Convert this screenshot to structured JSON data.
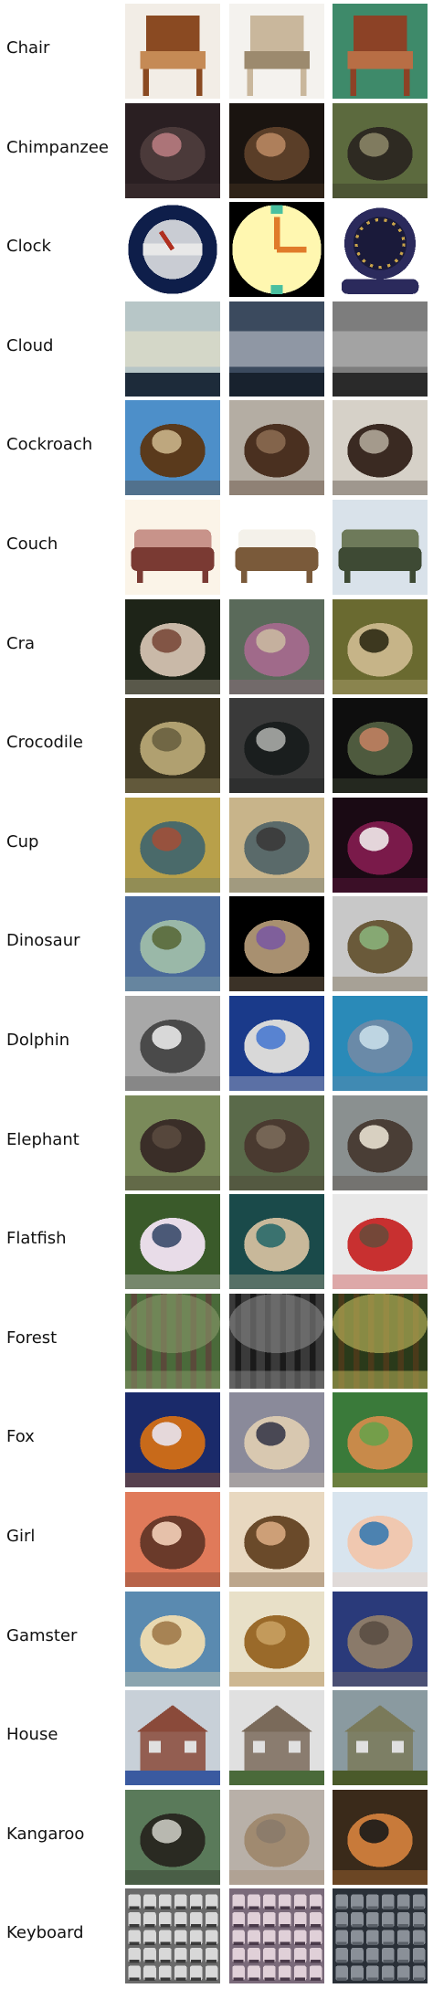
{
  "rows": [
    {
      "label": "Chair",
      "thumbs": [
        {
          "icon": "wooden-chair",
          "bg": "#f2ede6",
          "c1": "#8a4a22",
          "c2": "#c58a55"
        },
        {
          "icon": "padded-armchair",
          "bg": "#f4f2ee",
          "c1": "#c9b79c",
          "c2": "#9c8a6e"
        },
        {
          "icon": "leather-armchair",
          "bg": "#3e8a6a",
          "c1": "#8c4226",
          "c2": "#b86e45"
        }
      ]
    },
    {
      "label": "Chimpanzee",
      "thumbs": [
        {
          "icon": "chimp-face",
          "bg": "#2a1f22",
          "c1": "#4b3a3a",
          "c2": "#b77b7f"
        },
        {
          "icon": "chimp-face-close",
          "bg": "#1a1410",
          "c1": "#5a3e28",
          "c2": "#b78660"
        },
        {
          "icon": "chimp-on-ground",
          "bg": "#5c6a3e",
          "c1": "#2e2a22",
          "c2": "#8a8466"
        }
      ]
    },
    {
      "label": "Clock",
      "thumbs": [
        {
          "icon": "round-clock",
          "bg": "#ffffff",
          "c1": "#0e1e4a",
          "c2": "#c9ccd3"
        },
        {
          "icon": "cartoon-clock",
          "bg": "#000000",
          "c1": "#fff7b0",
          "c2": "#e07b2a"
        },
        {
          "icon": "table-clock",
          "bg": "#ffffff",
          "c1": "#2b2a5c",
          "c2": "#c9a44a"
        }
      ]
    },
    {
      "label": "Cloud",
      "thumbs": [
        {
          "icon": "sky-horizon",
          "bg": "#b7c6c7",
          "c1": "#e8e2c8",
          "c2": "#1d2b3a"
        },
        {
          "icon": "sky-horizon",
          "bg": "#3b4a5e",
          "c1": "#c8ccd4",
          "c2": "#18222e"
        },
        {
          "icon": "sky-horizon",
          "bg": "#7d7d7d",
          "c1": "#bdbdbd",
          "c2": "#2a2a2a"
        }
      ]
    },
    {
      "label": "Cockroach",
      "thumbs": [
        {
          "icon": "cockroach-on-wall",
          "bg": "#4d8fc9",
          "c1": "#5a3a1c",
          "c2": "#c9b48a"
        },
        {
          "icon": "cockroach",
          "bg": "#b4ada3",
          "c1": "#4a3020",
          "c2": "#8a6a50"
        },
        {
          "icon": "cockroach-small",
          "bg": "#d6d1c8",
          "c1": "#3a2a22",
          "c2": "#b0a698"
        }
      ]
    },
    {
      "label": "Couch",
      "thumbs": [
        {
          "icon": "small-sofa",
          "bg": "#fbf4e8",
          "c1": "#7a3a33",
          "c2": "#c8938a"
        },
        {
          "icon": "white-sofa",
          "bg": "#ffffff",
          "c1": "#7a5a3a",
          "c2": "#f4f1ea"
        },
        {
          "icon": "camo-sofa",
          "bg": "#d9e2ea",
          "c1": "#3e4a34",
          "c2": "#6e7a5a"
        }
      ]
    },
    {
      "label": "Cra",
      "thumbs": [
        {
          "icon": "spiny-crab",
          "bg": "#1e2418",
          "c1": "#c9b9a8",
          "c2": "#7a4a3a"
        },
        {
          "icon": "purple-crab",
          "bg": "#5a6a5a",
          "c1": "#a06a8a",
          "c2": "#c9b8a0"
        },
        {
          "icon": "crab-legs",
          "bg": "#6a6a30",
          "c1": "#c6b488",
          "c2": "#2e2a14"
        }
      ]
    },
    {
      "label": "Crocodile",
      "thumbs": [
        {
          "icon": "croc-top-view",
          "bg": "#3a3420",
          "c1": "#b0a070",
          "c2": "#6a6040"
        },
        {
          "icon": "croc-jaw",
          "bg": "#3a3a3a",
          "c1": "#1a1e1e",
          "c2": "#a8aaa6"
        },
        {
          "icon": "croc-head",
          "bg": "#0e0e0e",
          "c1": "#4e5a3e",
          "c2": "#c08060"
        }
      ]
    },
    {
      "label": "Cup",
      "thumbs": [
        {
          "icon": "trophy-cup",
          "bg": "#b8a04a",
          "c1": "#4a6a6a",
          "c2": "#a0503a"
        },
        {
          "icon": "goblet",
          "bg": "#c8b48a",
          "c1": "#5a6a6a",
          "c2": "#3a3a3a"
        },
        {
          "icon": "wine-glass",
          "bg": "#1a0a14",
          "c1": "#7a1a4a",
          "c2": "#f0eaea"
        }
      ]
    },
    {
      "label": "Dinosaur",
      "thumbs": [
        {
          "icon": "triceratops",
          "bg": "#4a6a9a",
          "c1": "#9ab8a8",
          "c2": "#5a6a3a"
        },
        {
          "icon": "raptor",
          "bg": "#000000",
          "c1": "#a89070",
          "c2": "#7a5aa0"
        },
        {
          "icon": "trex",
          "bg": "#c8c8c8",
          "c1": "#6a5a3a",
          "c2": "#8ab07a"
        }
      ]
    },
    {
      "label": "Dolphin",
      "thumbs": [
        {
          "icon": "dolphin-grey",
          "bg": "#a8a8a8",
          "c1": "#4a4a4a",
          "c2": "#e8e8e8"
        },
        {
          "icon": "dolphin-leap",
          "bg": "#1a3a8a",
          "c1": "#d8d8d8",
          "c2": "#4a7ad0"
        },
        {
          "icon": "dolphin-head",
          "bg": "#2a8ab8",
          "c1": "#6a8aa8",
          "c2": "#c8dde8"
        }
      ]
    },
    {
      "label": "Elephant",
      "thumbs": [
        {
          "icon": "elephant-side",
          "bg": "#7a8a5a",
          "c1": "#3a2e28",
          "c2": "#5a4a3e"
        },
        {
          "icon": "elephant-front",
          "bg": "#5a6a4a",
          "c1": "#4a3a30",
          "c2": "#7a6a5a"
        },
        {
          "icon": "elephant-tusk",
          "bg": "#8a9090",
          "c1": "#4a3e36",
          "c2": "#e8e0d0"
        }
      ]
    },
    {
      "label": "Flatfish",
      "thumbs": [
        {
          "icon": "person-with-fish",
          "bg": "#3a5a2a",
          "c1": "#e8dce8",
          "c2": "#3a4a6a"
        },
        {
          "icon": "flatfish-sand",
          "bg": "#1a4a4a",
          "c1": "#c8b89a",
          "c2": "#2a6a6a"
        },
        {
          "icon": "person-with-fish",
          "bg": "#e8e8e8",
          "c1": "#c83030",
          "c2": "#6a4a3a"
        }
      ]
    },
    {
      "label": "Forest",
      "thumbs": [
        {
          "icon": "woods",
          "bg": "#4a6a3a",
          "c1": "#8a9a6a",
          "c2": "#5a4a3a"
        },
        {
          "icon": "woods",
          "bg": "#3a3a3a",
          "c1": "#8a8a8a",
          "c2": "#1a1a1a"
        },
        {
          "icon": "woods",
          "bg": "#2a3a1a",
          "c1": "#c8c060",
          "c2": "#4a3a1a"
        }
      ]
    },
    {
      "label": "Fox",
      "thumbs": [
        {
          "icon": "fox-standing",
          "bg": "#1a2a6a",
          "c1": "#c86a1a",
          "c2": "#e8e4f0"
        },
        {
          "icon": "fox-face",
          "bg": "#8a8a9a",
          "c1": "#d8c8b0",
          "c2": "#3a3a4a"
        },
        {
          "icon": "fox-cubs",
          "bg": "#3a7a3a",
          "c1": "#c88a4a",
          "c2": "#6aa04a"
        }
      ]
    },
    {
      "label": "Girl",
      "thumbs": [
        {
          "icon": "girl-smiling",
          "bg": "#e07a5a",
          "c1": "#6a3a2a",
          "c2": "#f4d0b8"
        },
        {
          "icon": "girl-group",
          "bg": "#e8d8c0",
          "c1": "#6a4a2a",
          "c2": "#d8a880"
        },
        {
          "icon": "girl-face-close",
          "bg": "#d8e4ee",
          "c1": "#f0c8b0",
          "c2": "#3a7ab0"
        }
      ]
    },
    {
      "label": "Gamster",
      "thumbs": [
        {
          "icon": "hamster",
          "bg": "#5a8ab0",
          "c1": "#e8d8b0",
          "c2": "#a07a4a"
        },
        {
          "icon": "hamster-brown",
          "bg": "#e8e0c8",
          "c1": "#9a6a2a",
          "c2": "#c8a060"
        },
        {
          "icon": "hamster-head",
          "bg": "#2a3a7a",
          "c1": "#8a7a6a",
          "c2": "#5a4e44"
        }
      ]
    },
    {
      "label": "House",
      "thumbs": [
        {
          "icon": "brick-house",
          "bg": "#c8d0d8",
          "c1": "#8a4a3a",
          "c2": "#3a5aa0"
        },
        {
          "icon": "street-houses",
          "bg": "#e0e0e0",
          "c1": "#7a6a5a",
          "c2": "#4a6a3a"
        },
        {
          "icon": "stone-house",
          "bg": "#8a9aa0",
          "c1": "#7a7a5a",
          "c2": "#4a5a2a"
        }
      ]
    },
    {
      "label": "Kangaroo",
      "thumbs": [
        {
          "icon": "kangaroo-joey",
          "bg": "#5a7a5a",
          "c1": "#2a2a22",
          "c2": "#c8c8c0"
        },
        {
          "icon": "kangaroo-sitting",
          "bg": "#b8b0a8",
          "c1": "#a08a70",
          "c2": "#8a7a6a"
        },
        {
          "icon": "kangaroo-standing",
          "bg": "#3a2a1a",
          "c1": "#c87a3a",
          "c2": "#1a1a1a"
        }
      ]
    },
    {
      "label": "Keyboard",
      "thumbs": [
        {
          "icon": "keyboard",
          "bg": "#6a6a6a",
          "c1": "#d8d8d8",
          "c2": "#3a3a3a"
        },
        {
          "icon": "keyboard-angled",
          "bg": "#7a6a7a",
          "c1": "#e0d0d8",
          "c2": "#4a3a4a"
        },
        {
          "icon": "keyboard-keys",
          "bg": "#2a3038",
          "c1": "#8a9098",
          "c2": "#5a6068"
        }
      ]
    }
  ]
}
